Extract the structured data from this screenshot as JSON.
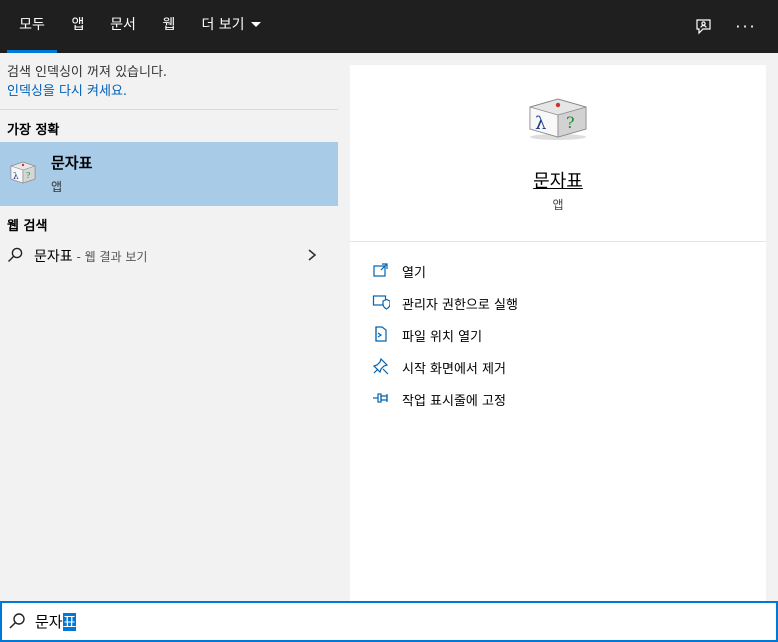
{
  "tabs": [
    {
      "label": "모두",
      "active": true
    },
    {
      "label": "앱"
    },
    {
      "label": "문서"
    },
    {
      "label": "웹"
    },
    {
      "label": "더 보기"
    }
  ],
  "topbar": {
    "more_icon": "ellipsis-icon",
    "feedback_icon": "feedback-icon",
    "more_text": "···"
  },
  "notice": {
    "text": "검색 인덱싱이 꺼져 있습니다.",
    "link": "인덱싱을 다시 켜세요."
  },
  "best_match": {
    "title": "가장 정확",
    "name": "문자표",
    "kind": "앱"
  },
  "web_search": {
    "title": "웹 검색",
    "query": "문자표",
    "suffix": " - 웹 결과 보기"
  },
  "detail": {
    "name": "문자표",
    "kind": "앱",
    "actions": [
      {
        "label": "열기",
        "icon": "open-icon"
      },
      {
        "label": "관리자 권한으로 실행",
        "icon": "shield-icon"
      },
      {
        "label": "파일 위치 열기",
        "icon": "file-location-icon"
      },
      {
        "label": "시작 화면에서 제거",
        "icon": "unpin-icon"
      },
      {
        "label": "작업 표시줄에 고정",
        "icon": "pin-icon"
      }
    ]
  },
  "search": {
    "typed": "문자",
    "selected": "표"
  },
  "colors": {
    "accent": "#0078d7",
    "highlight": "#a8cbe8",
    "topbar": "#1f1f1f",
    "link": "#005fb8"
  }
}
